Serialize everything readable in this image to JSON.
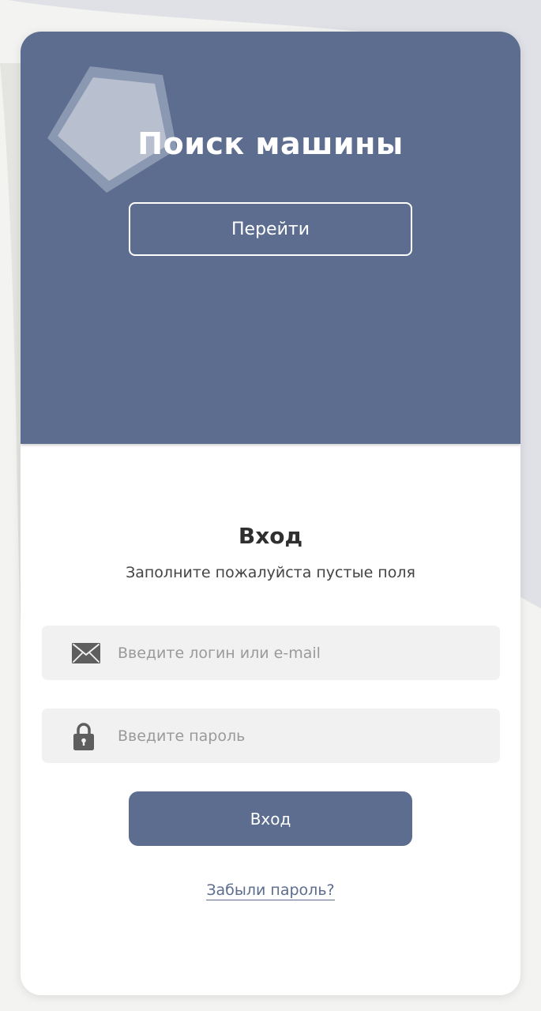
{
  "theme": {
    "accent": "#5c6d8f",
    "card_background": "#ffffff",
    "page_background": "#f3f3f1",
    "field_background": "#f1f1f1"
  },
  "hero": {
    "title": "Поиск машины",
    "go_button_label": "Перейти",
    "decor_icon": "pentagon-shape"
  },
  "login": {
    "title": "Вход",
    "subtitle": "Заполните пожалуйста пустые поля",
    "login_field": {
      "icon": "envelope-icon",
      "placeholder": "Введите логин или e-mail",
      "value": ""
    },
    "password_field": {
      "icon": "lock-icon",
      "placeholder": "Введите пароль",
      "value": ""
    },
    "submit_label": "Вход",
    "forgot_password_label": "Забыли пароль?"
  }
}
